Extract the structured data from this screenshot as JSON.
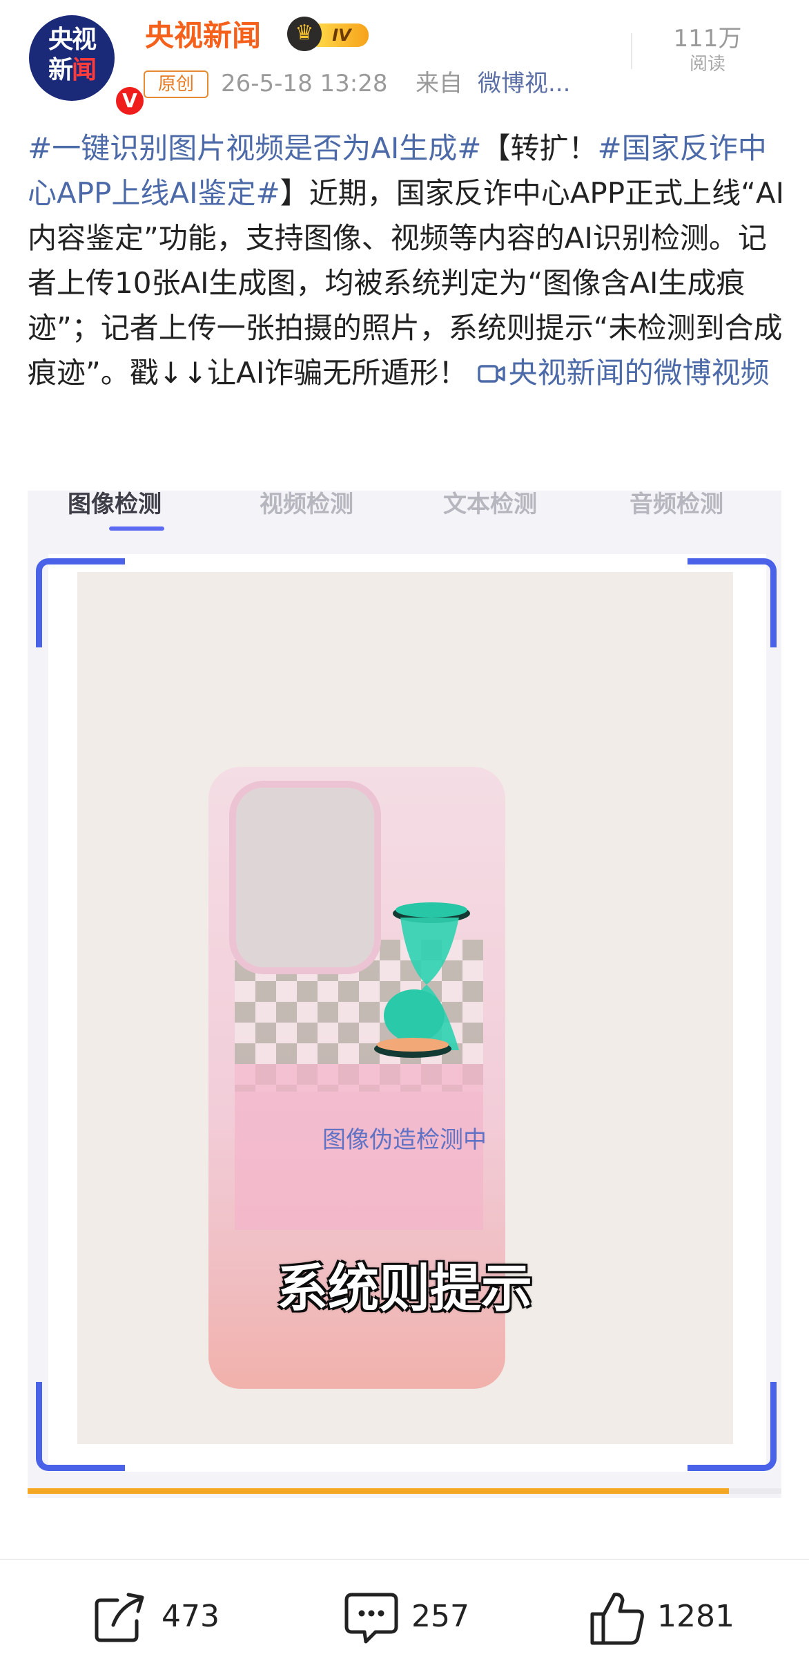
{
  "header": {
    "avatar_line1": "央视",
    "avatar_line2a": "新",
    "avatar_line2b": "闻",
    "verified_mark": "V",
    "author_name": "央视新闻",
    "level_badge": "IV",
    "original_badge": "原创",
    "timestamp": "26-5-18 13:28",
    "source_prefix": "来自",
    "source": "微博视...",
    "read_count": "111万",
    "read_label": "阅读"
  },
  "post": {
    "tag1": "#一键识别图片视频是否为AI生成#",
    "seg1": "【转扩！",
    "tag2": "#国家反诈中心APP上线AI鉴定#",
    "seg2": "】近期，国家反诈中心APP正式上线“AI内容鉴定”功能，支持图像、视频等内容的AI识别检测。记者上传10张AI生成图，均被系统判定为“图像含AI生成痕迹”；记者上传一张拍摄的照片，系统则提示“未检测到合成痕迹”。戳↓↓让AI诈骗无所遁形！",
    "video_link": "央视新闻的微博视频"
  },
  "video": {
    "tabs": [
      "图像检测",
      "视频检测",
      "文本检测",
      "音频检测"
    ],
    "active_tab": 0,
    "detecting_text": "图像伪造检测中",
    "subtitle": "系统则提示",
    "progress": 0.93
  },
  "actions": {
    "share_count": "473",
    "comment_count": "257",
    "like_count": "1281"
  },
  "colors": {
    "author_orange": "#f5601a",
    "link_blue": "#4d6aa8",
    "scan_blue": "#4a62e8",
    "progress_orange": "#f5a623"
  },
  "icons": [
    "verified-icon",
    "crown-icon",
    "video-link-icon",
    "hourglass-icon",
    "share-icon",
    "comment-icon",
    "like-icon"
  ]
}
